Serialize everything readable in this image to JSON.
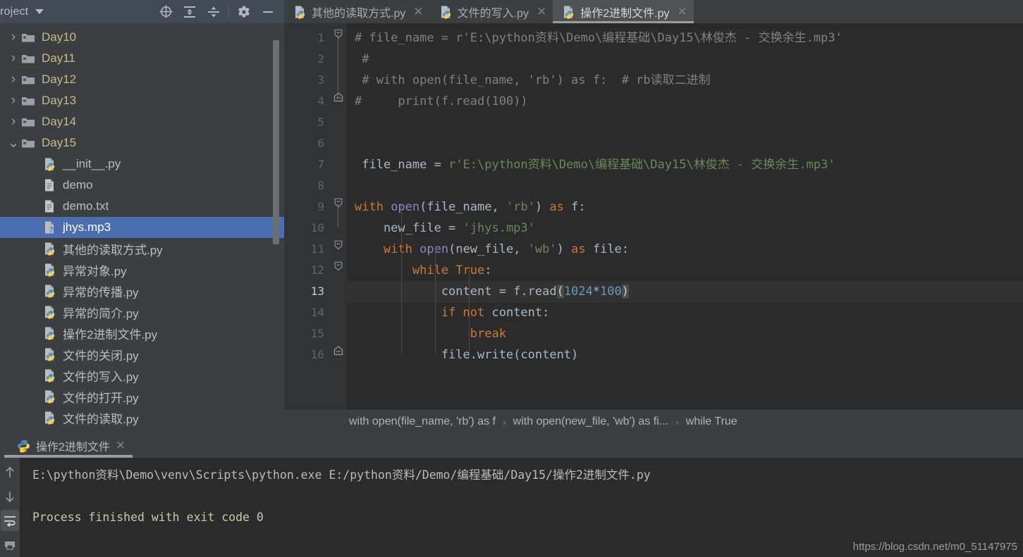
{
  "project_panel": {
    "title": "roject",
    "toolbar": [
      {
        "name": "locate-icon",
        "tooltip": "Select Opened File"
      },
      {
        "name": "expand-all-icon",
        "tooltip": "Expand All"
      },
      {
        "name": "collapse-all-icon",
        "tooltip": "Collapse All"
      },
      {
        "name": "settings-gear-icon",
        "tooltip": "Settings"
      },
      {
        "name": "minimize-icon",
        "tooltip": "Hide"
      }
    ],
    "tree": [
      {
        "label": "Day10",
        "type": "folder",
        "expanded": false,
        "depth": 0
      },
      {
        "label": "Day11",
        "type": "folder",
        "expanded": false,
        "depth": 0
      },
      {
        "label": "Day12",
        "type": "folder",
        "expanded": false,
        "depth": 0
      },
      {
        "label": "Day13",
        "type": "folder",
        "expanded": false,
        "depth": 0
      },
      {
        "label": "Day14",
        "type": "folder",
        "expanded": false,
        "depth": 0
      },
      {
        "label": "Day15",
        "type": "folder",
        "expanded": true,
        "depth": 0
      },
      {
        "label": "__init__.py",
        "type": "python",
        "depth": 1
      },
      {
        "label": "demo",
        "type": "file",
        "depth": 1
      },
      {
        "label": "demo.txt",
        "type": "file",
        "depth": 1
      },
      {
        "label": "jhys.mp3",
        "type": "unknown",
        "depth": 1,
        "selected": true
      },
      {
        "label": "其他的读取方式.py",
        "type": "python",
        "depth": 1
      },
      {
        "label": "异常对象.py",
        "type": "python",
        "depth": 1
      },
      {
        "label": "异常的传播.py",
        "type": "python",
        "depth": 1
      },
      {
        "label": "异常的简介.py",
        "type": "python",
        "depth": 1
      },
      {
        "label": "操作2进制文件.py",
        "type": "python",
        "depth": 1
      },
      {
        "label": "文件的关闭.py",
        "type": "python",
        "depth": 1
      },
      {
        "label": "文件的写入.py",
        "type": "python",
        "depth": 1
      },
      {
        "label": "文件的打开.py",
        "type": "python",
        "depth": 1
      },
      {
        "label": "文件的读取.py",
        "type": "python",
        "depth": 1
      }
    ]
  },
  "editor": {
    "tabs": [
      {
        "label": "其他的读取方式.py",
        "active": false
      },
      {
        "label": "文件的写入.py",
        "active": false
      },
      {
        "label": "操作2进制文件.py",
        "active": true
      }
    ],
    "close_glyph": "✕",
    "line_numbers": [
      "1",
      "2",
      "3",
      "4",
      "5",
      "6",
      "7",
      "8",
      "9",
      "10",
      "11",
      "12",
      "13",
      "14",
      "15",
      "16"
    ],
    "active_line": 13,
    "lines": [
      {
        "n": 1,
        "tokens": [
          {
            "t": "# file_name = r'E:\\python资料\\Demo\\编程基础\\Day15\\林俊杰 - 交换余生.mp3'",
            "c": "cmt"
          }
        ]
      },
      {
        "n": 2,
        "tokens": [
          {
            "t": " #",
            "c": "cmt"
          }
        ]
      },
      {
        "n": 3,
        "tokens": [
          {
            "t": " # with open(file_name, 'rb') as f:  # rb读取二进制",
            "c": "cmt"
          }
        ]
      },
      {
        "n": 4,
        "tokens": [
          {
            "t": "#     print(f.read(100))",
            "c": "cmt"
          }
        ]
      },
      {
        "n": 5,
        "tokens": []
      },
      {
        "n": 6,
        "tokens": []
      },
      {
        "n": 7,
        "tokens": [
          {
            "t": " file_name ",
            "c": "var"
          },
          {
            "t": "= ",
            "c": "var"
          },
          {
            "t": "r'E:\\python资料\\Demo\\编程基础\\Day15\\林俊杰 - 交换余生.mp3'",
            "c": "str"
          }
        ]
      },
      {
        "n": 8,
        "tokens": []
      },
      {
        "n": 9,
        "tokens": [
          {
            "t": "with ",
            "c": "kw"
          },
          {
            "t": "open",
            "c": "fn"
          },
          {
            "t": "(file_name, ",
            "c": "var"
          },
          {
            "t": "'rb'",
            "c": "str"
          },
          {
            "t": ") ",
            "c": "var"
          },
          {
            "t": "as ",
            "c": "kw"
          },
          {
            "t": "f:",
            "c": "var"
          }
        ]
      },
      {
        "n": 10,
        "tokens": [
          {
            "t": "    new_file = ",
            "c": "var"
          },
          {
            "t": "'jhys.mp3'",
            "c": "str"
          }
        ]
      },
      {
        "n": 11,
        "tokens": [
          {
            "t": "    ",
            "c": "var"
          },
          {
            "t": "with ",
            "c": "kw"
          },
          {
            "t": "open",
            "c": "fn"
          },
          {
            "t": "(new_file, ",
            "c": "var"
          },
          {
            "t": "'wb'",
            "c": "str"
          },
          {
            "t": ") ",
            "c": "var"
          },
          {
            "t": "as ",
            "c": "kw"
          },
          {
            "t": "file:",
            "c": "var"
          }
        ]
      },
      {
        "n": 12,
        "tokens": [
          {
            "t": "        ",
            "c": "var"
          },
          {
            "t": "while ",
            "c": "kw"
          },
          {
            "t": "True",
            "c": "kw"
          },
          {
            "t": ":",
            "c": "var"
          }
        ]
      },
      {
        "n": 13,
        "tokens": [
          {
            "t": "            content = f.read",
            "c": "var"
          },
          {
            "t": "(",
            "c": "brk"
          },
          {
            "t": "1024",
            "c": "num"
          },
          {
            "t": "*",
            "c": "var"
          },
          {
            "t": "100",
            "c": "num"
          },
          {
            "t": ")",
            "c": "brk"
          }
        ]
      },
      {
        "n": 14,
        "tokens": [
          {
            "t": "            ",
            "c": "var"
          },
          {
            "t": "if not ",
            "c": "kw"
          },
          {
            "t": "content:",
            "c": "var"
          }
        ]
      },
      {
        "n": 15,
        "tokens": [
          {
            "t": "                ",
            "c": "var"
          },
          {
            "t": "break",
            "c": "kw"
          }
        ]
      },
      {
        "n": 16,
        "tokens": [
          {
            "t": "            file.write(content)",
            "c": "var"
          }
        ]
      }
    ],
    "breadcrumbs": [
      "with open(file_name, 'rb') as f",
      "with open(new_file, 'wb') as fi...",
      "while True"
    ],
    "breadcrumb_separator": "›"
  },
  "console": {
    "tab_label": "操作2进制文件",
    "close_glyph": "✕",
    "side_buttons": [
      {
        "name": "scroll-up-icon",
        "active": false
      },
      {
        "name": "scroll-down-icon",
        "active": false
      },
      {
        "name": "soft-wrap-icon",
        "active": true
      },
      {
        "name": "print-icon",
        "active": false
      }
    ],
    "output": [
      {
        "text": "E:\\python资料\\Demo\\venv\\Scripts\\python.exe E:/python资料/Demo/编程基础/Day15/操作2进制文件.py",
        "style": "normal"
      },
      {
        "text": "",
        "style": "normal"
      },
      {
        "text": "Process finished with exit code 0",
        "style": "exitmsg"
      }
    ]
  },
  "watermark": "https://blog.csdn.net/m0_51147975",
  "colors": {
    "panel_bg": "#3c3f41",
    "header_bg": "#414a54",
    "editor_bg": "#2b2b2b",
    "gutter_bg": "#313335",
    "selection_blue": "#4b6eaf",
    "tab_active_bg": "#4e5254",
    "folder_text": "#c8b88a",
    "keyword_orange": "#cc7832",
    "string_green": "#6a8759",
    "number_blue": "#6897bb",
    "function_purple": "#8888c6",
    "comment_gray": "#808080",
    "default_text": "#a9b7c6"
  }
}
